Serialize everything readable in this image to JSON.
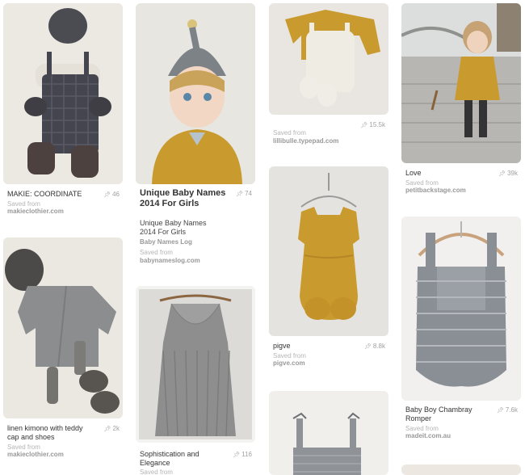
{
  "pins": {
    "p1": {
      "title": "MAKIE: COORDINATE",
      "count": "46",
      "saved": "Saved from",
      "source": "makieclothier.com"
    },
    "p2": {
      "title": "Unique Baby Names 2014 For Girls",
      "desc": "Unique Baby Names 2014 For Girls",
      "board": "Baby Names Log",
      "count": "74",
      "saved": "Saved from",
      "source": "babynameslog.com"
    },
    "p3": {
      "count": "15.5k",
      "saved": "Saved from",
      "source": "lillibulle.typepad.com"
    },
    "p4": {
      "title": "Love",
      "count": "39k",
      "saved": "Saved from",
      "source": "petitbackstage.com"
    },
    "p5": {
      "title": "linen kimono with teddy cap and shoes",
      "count": "2k",
      "saved": "Saved from",
      "source": "makieclothier.com"
    },
    "p6": {
      "title": "pigve",
      "count": "8.8k",
      "saved": "Saved from",
      "source": "pigve.com"
    },
    "p7": {
      "title": "Baby Boy Chambray Romper",
      "count": "7.6k",
      "saved": "Saved from",
      "source": "madeit.com.au"
    },
    "p8": {
      "title": "Sophistication and Elegance",
      "count": "116",
      "saved": "Saved from"
    }
  },
  "icons": {
    "pin_count": "pushpin-icon"
  },
  "colors": {
    "mustard": "#c99a2e",
    "grey_knit": "#8d8d8d",
    "plaid": "#45454f",
    "bg": "#ffffff"
  }
}
